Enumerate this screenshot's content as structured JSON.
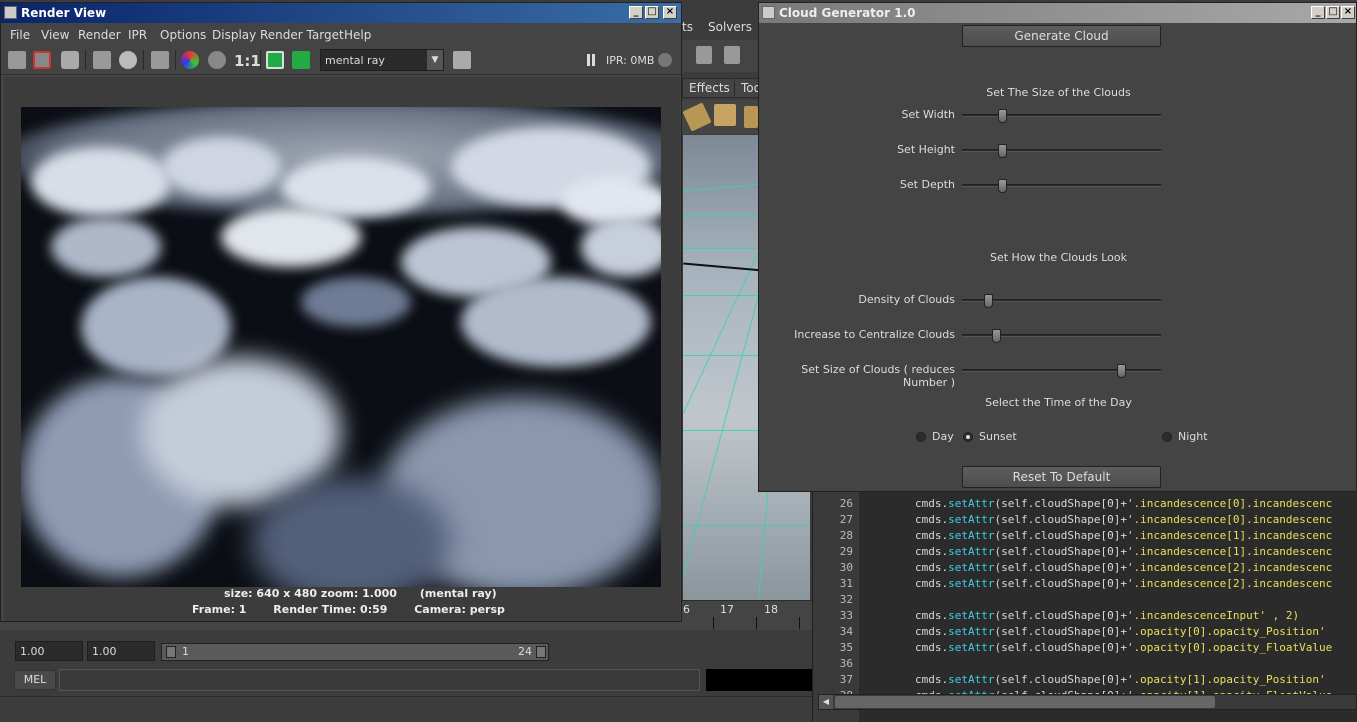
{
  "background_app": {
    "menus": [
      "ts",
      "Solvers"
    ],
    "tabs": [
      "Effects",
      "Too"
    ],
    "timeline_ticks": [
      "6",
      "17",
      "18"
    ],
    "range": {
      "start_field": "1.00",
      "end_field": "1.00",
      "range_start": "1",
      "range_end": "24"
    },
    "command_label": "MEL"
  },
  "script_editor": {
    "lines": [
      {
        "n": "26",
        "pre": "cmds.",
        "fn": "setAttr",
        "mid": "(self.cloudShape[0]+",
        "str": "'.incandescence[0].incandescenc"
      },
      {
        "n": "27",
        "pre": "cmds.",
        "fn": "setAttr",
        "mid": "(self.cloudShape[0]+",
        "str": "'.incandescence[0].incandescenc"
      },
      {
        "n": "28",
        "pre": "cmds.",
        "fn": "setAttr",
        "mid": "(self.cloudShape[0]+",
        "str": "'.incandescence[1].incandescenc"
      },
      {
        "n": "29",
        "pre": "cmds.",
        "fn": "setAttr",
        "mid": "(self.cloudShape[0]+",
        "str": "'.incandescence[1].incandescenc"
      },
      {
        "n": "30",
        "pre": "cmds.",
        "fn": "setAttr",
        "mid": "(self.cloudShape[0]+",
        "str": "'.incandescence[2].incandescenc"
      },
      {
        "n": "31",
        "pre": "cmds.",
        "fn": "setAttr",
        "mid": "(self.cloudShape[0]+",
        "str": "'.incandescence[2].incandescenc"
      },
      {
        "n": "32",
        "pre": "",
        "fn": "",
        "mid": "",
        "str": ""
      },
      {
        "n": "33",
        "pre": "cmds.",
        "fn": "setAttr",
        "mid": "(self.cloudShape[0]+",
        "str": "'.incandescenceInput' , 2)"
      },
      {
        "n": "34",
        "pre": "cmds.",
        "fn": "setAttr",
        "mid": "(self.cloudShape[0]+",
        "str": "'.opacity[0].opacity_Position'"
      },
      {
        "n": "35",
        "pre": "cmds.",
        "fn": "setAttr",
        "mid": "(self.cloudShape[0]+",
        "str": "'.opacity[0].opacity_FloatValue"
      },
      {
        "n": "36",
        "pre": "",
        "fn": "",
        "mid": "",
        "str": ""
      },
      {
        "n": "37",
        "pre": "cmds.",
        "fn": "setAttr",
        "mid": "(self.cloudShape[0]+",
        "str": "'.opacity[1].opacity_Position'"
      },
      {
        "n": "38",
        "pre": "cmds.",
        "fn": "setAttr",
        "mid": "(self.cloudShape[0]+",
        "str": "'.opacity[1].opacity_FloatValue"
      }
    ]
  },
  "render_view": {
    "title": "Render View",
    "menus": [
      "File",
      "View",
      "Render",
      "IPR",
      "Options",
      "Display",
      "Render Target",
      "Help"
    ],
    "renderer": "mental ray",
    "ratio_label": "1:1",
    "ipr_status": "IPR: 0MB",
    "info_line1": "size: 640 x 480 zoom: 1.000      (mental ray)",
    "info_line2": "Frame: 1       Render Time: 0:59       Camera: persp"
  },
  "cloud_generator": {
    "title": "Cloud Generator 1.0",
    "generate_button": "Generate Cloud",
    "size_heading": "Set The Size of the Clouds",
    "size_sliders": [
      {
        "label": "Set Width",
        "value": 0.2
      },
      {
        "label": "Set Height",
        "value": 0.2
      },
      {
        "label": "Set Depth",
        "value": 0.2
      }
    ],
    "look_heading": "Set How the Clouds Look",
    "look_sliders": [
      {
        "label": "Density of Clouds",
        "value": 0.13
      },
      {
        "label": "Increase to Centralize Clouds",
        "value": 0.17
      },
      {
        "label": "Set Size of Clouds ( reduces Number )",
        "value": 0.8
      }
    ],
    "time_heading": "Select the Time of the Day",
    "time_options": [
      {
        "label": "Day",
        "checked": false
      },
      {
        "label": "Sunset",
        "checked": true
      },
      {
        "label": "Night",
        "checked": false
      }
    ],
    "reset_button": "Reset To Default"
  }
}
